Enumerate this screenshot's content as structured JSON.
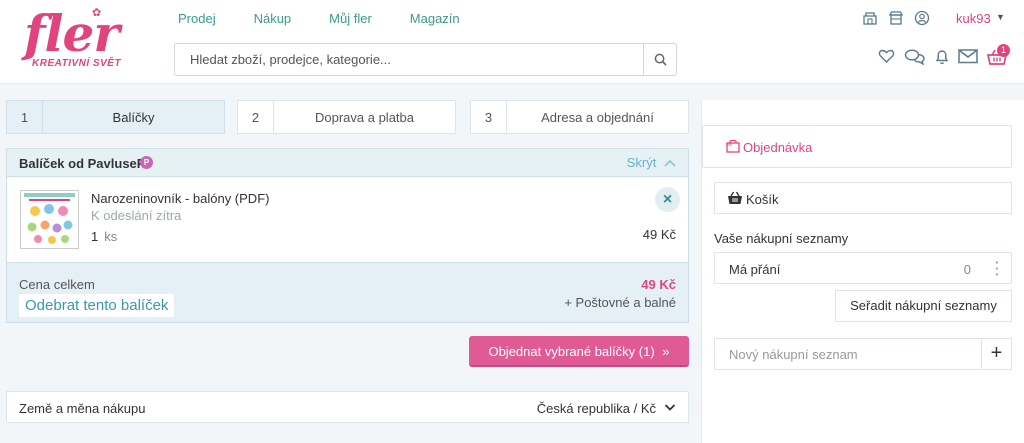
{
  "header": {
    "logo_text": "fler",
    "logo_tagline": "KREATIVNÍ SVĚT",
    "nav": [
      {
        "label": "Prodej"
      },
      {
        "label": "Nákup"
      },
      {
        "label": "Můj fler"
      },
      {
        "label": "Magazín"
      }
    ],
    "search": {
      "placeholder": "Hledat zboží, prodejce, kategorie...",
      "value": ""
    },
    "username": "kuk93",
    "cart_count": "1",
    "icons": [
      "shop-icon",
      "store-icon",
      "user-icon",
      "heart-icon",
      "chat-icon",
      "bell-icon",
      "mail-icon",
      "basket-icon"
    ]
  },
  "steps": [
    {
      "num": "1",
      "label": "Balíčky",
      "active": true
    },
    {
      "num": "2",
      "label": "Doprava a platba",
      "active": false
    },
    {
      "num": "3",
      "label": "Adresa a objednání",
      "active": false
    }
  ],
  "package": {
    "title": "Balíček od PavluseP",
    "seller_badge": "P",
    "hide_label": "Skrýt",
    "item": {
      "name": "Narozeninovník - balóny (PDF)",
      "shipping": "K odeslání zítra",
      "qty": "1",
      "qty_unit": "ks",
      "price": "49 Kč"
    },
    "total_label": "Cena celkem",
    "total_value": "49 Kč",
    "remove_label": "Odebrat tento balíček",
    "postage_label": "+ Poštovné a balné"
  },
  "order_button": "Objednat vybrané balíčky (1)",
  "country": {
    "label": "Země a měna nákupu",
    "value": "Česká republika / Kč"
  },
  "sidebar": {
    "tab_label": "Objednávka",
    "cart_label": "Košík",
    "lists_heading": "Vaše nákupní seznamy",
    "lists": [
      {
        "name": "Má přání",
        "count": "0"
      }
    ],
    "sort_label": "Seřadit nákupní seznamy",
    "new_list_placeholder": "Nový nákupní seznam"
  },
  "colors": {
    "brand": "#e0447f",
    "accent": "#3a9a8c",
    "order_button": "#e05a94"
  }
}
